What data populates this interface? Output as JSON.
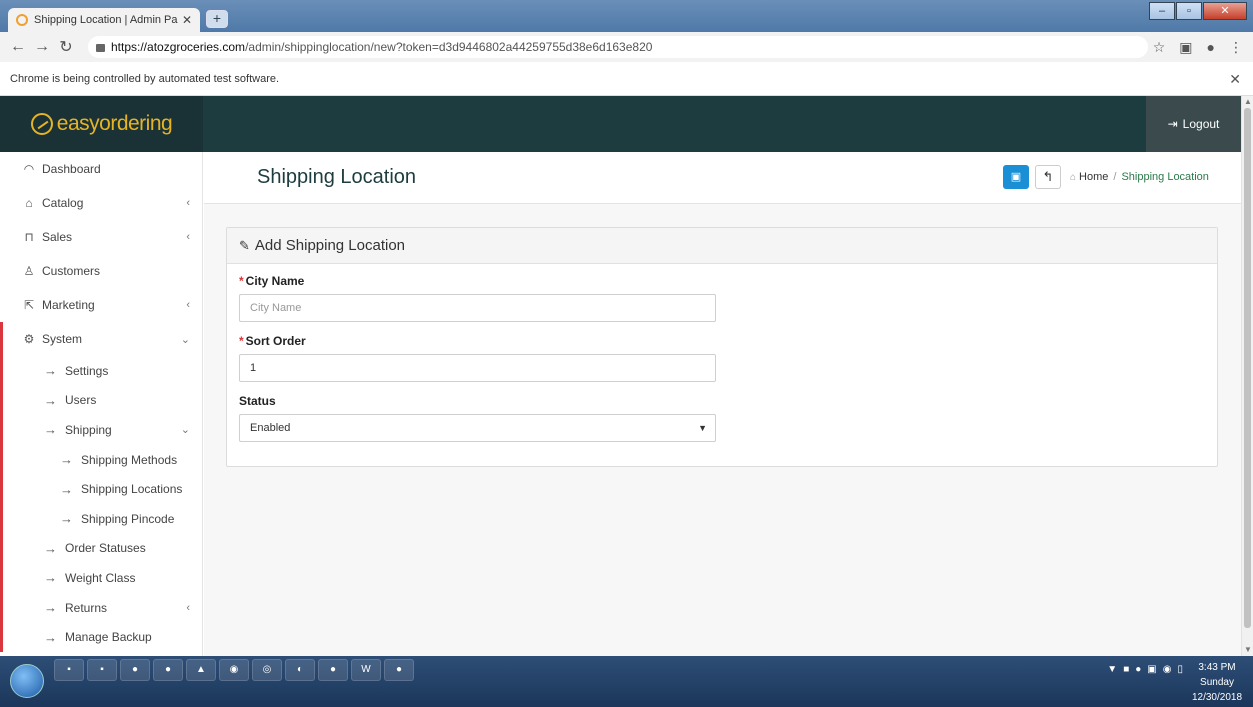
{
  "browser": {
    "tab_title": "Shipping Location | Admin Panel",
    "url_host": "https://atozgroceries.com",
    "url_path": "/admin/shippinglocation/new?token=d3d9446802a44259755d38e6d163e820",
    "info_text": "Chrome is being controlled by automated test software."
  },
  "header": {
    "brand": "easyordering",
    "logout_label": "Logout"
  },
  "sidebar": {
    "items": [
      {
        "label": "Dashboard",
        "icon": "dashboard-icon"
      },
      {
        "label": "Catalog",
        "icon": "catalog-icon"
      },
      {
        "label": "Sales",
        "icon": "cart-icon"
      },
      {
        "label": "Customers",
        "icon": "user-icon"
      },
      {
        "label": "Marketing",
        "icon": "share-icon"
      },
      {
        "label": "System",
        "icon": "gear-icon"
      }
    ],
    "system_sub": [
      {
        "label": "Settings"
      },
      {
        "label": "Users"
      },
      {
        "label": "Shipping"
      },
      {
        "label": "Shipping Methods"
      },
      {
        "label": "Shipping Locations"
      },
      {
        "label": "Shipping Pincode"
      },
      {
        "label": "Order Statuses"
      },
      {
        "label": "Weight Class"
      },
      {
        "label": "Returns"
      },
      {
        "label": "Manage Backup"
      }
    ]
  },
  "page": {
    "title": "Shipping Location",
    "breadcrumb_home": "Home",
    "breadcrumb_sep": "/",
    "breadcrumb_current": "Shipping Location"
  },
  "form": {
    "panel_title": "Add Shipping Location",
    "city_label": "City Name",
    "city_placeholder": "City Name",
    "city_value": "",
    "sort_label": "Sort Order",
    "sort_value": "1",
    "status_label": "Status",
    "status_value": "Enabled",
    "required_mark": "*"
  },
  "taskbar": {
    "time": "3:43 PM",
    "day": "Sunday",
    "date": "12/30/2018"
  }
}
